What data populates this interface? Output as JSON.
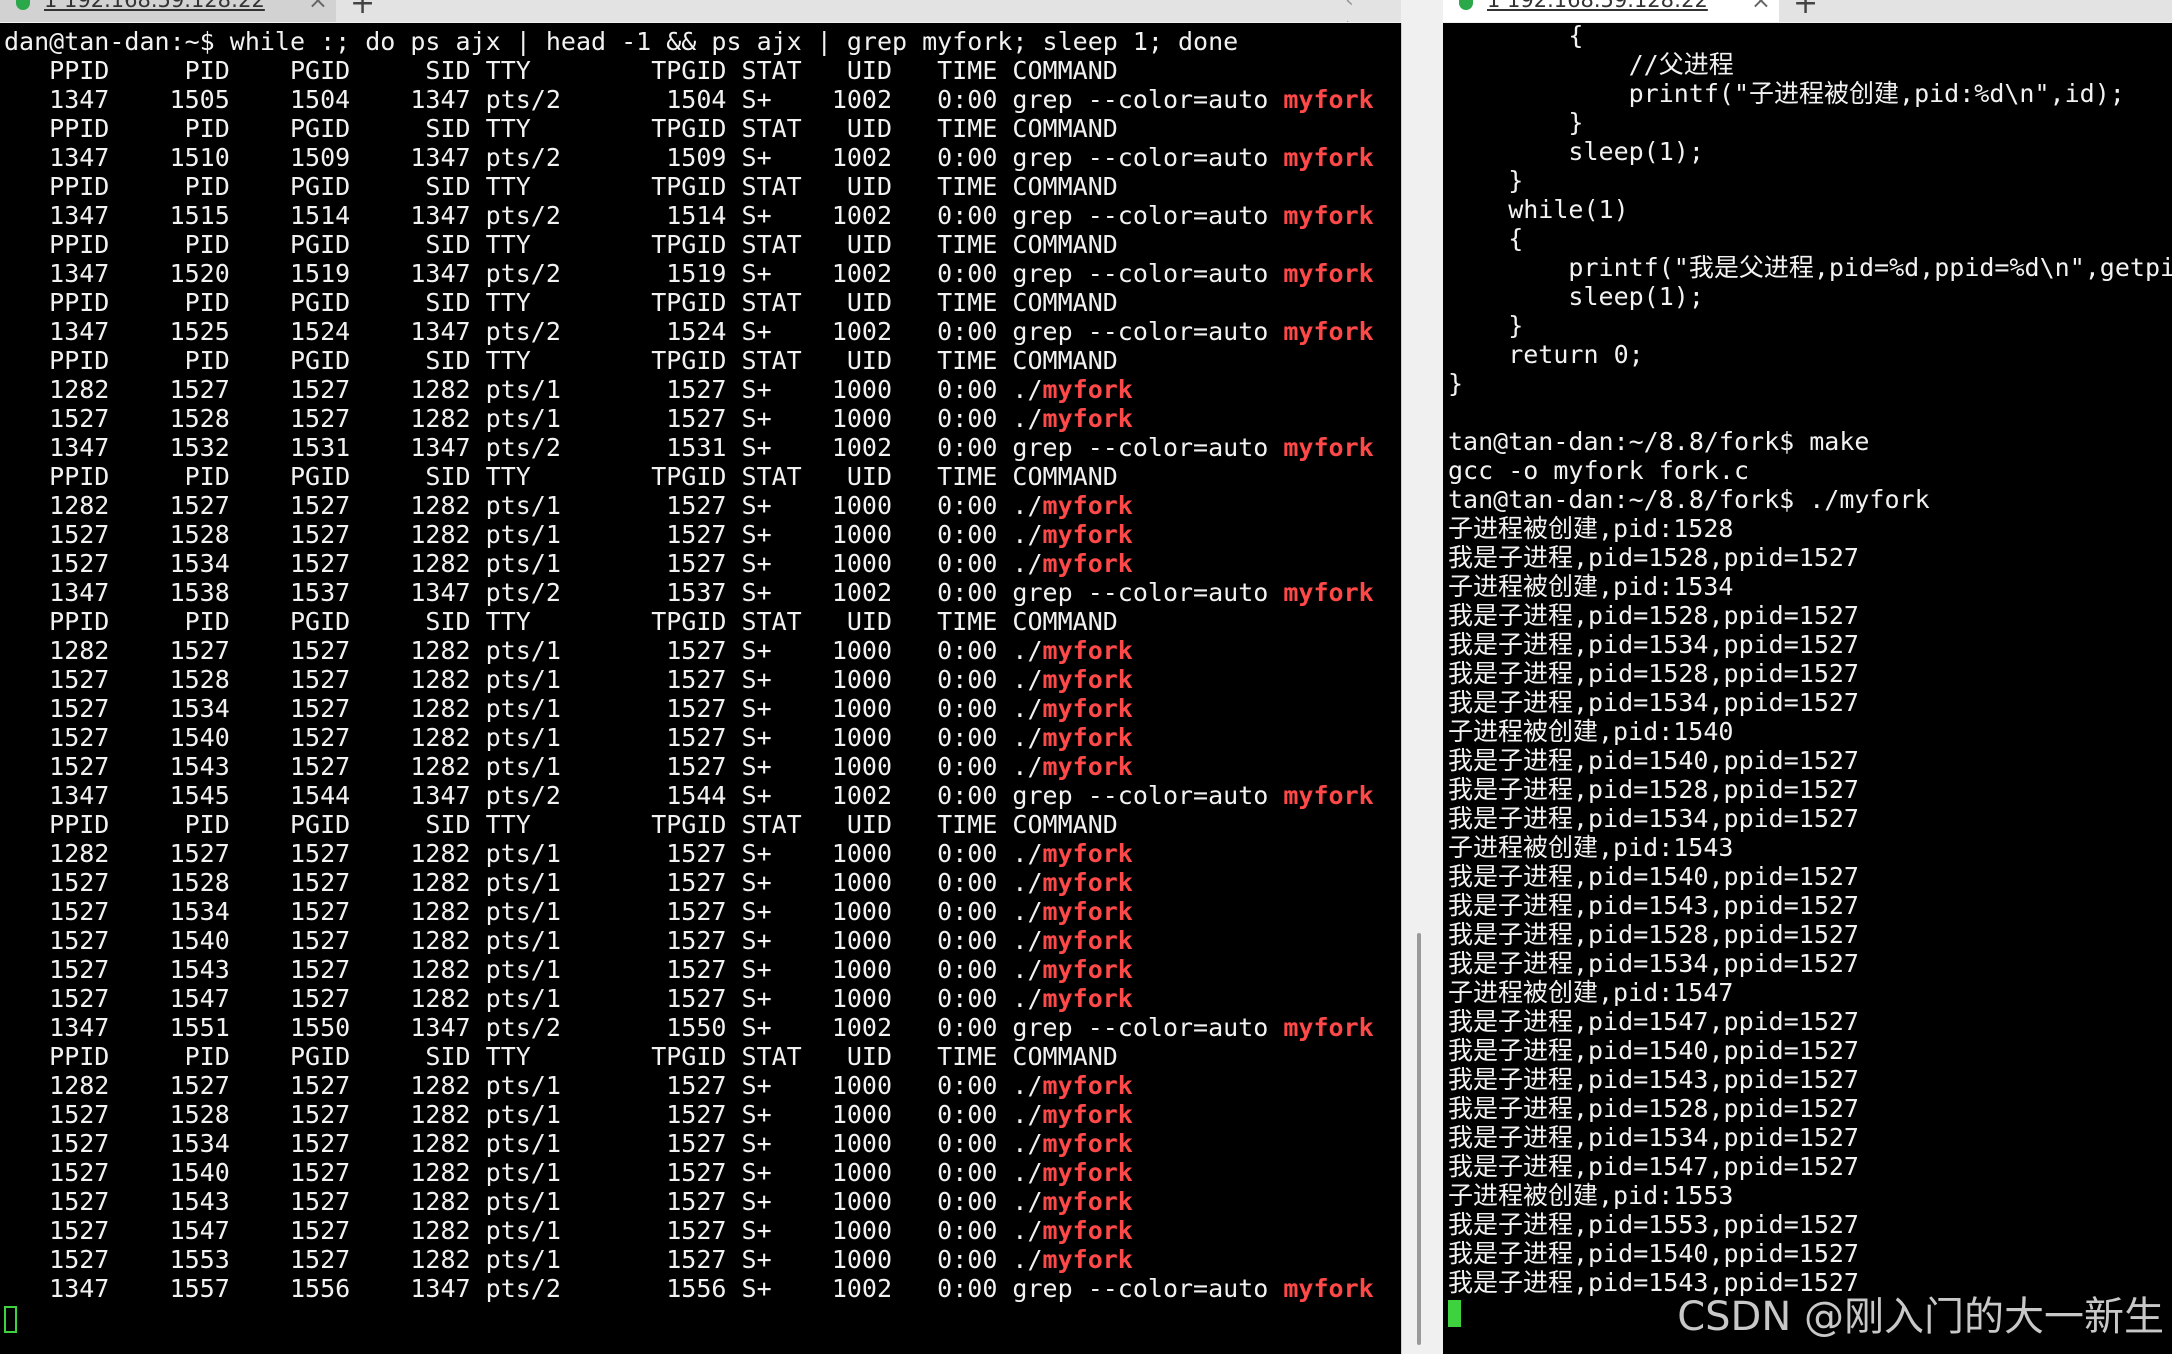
{
  "left_tab": {
    "label": "1 192.168.59.128:22",
    "close": "×",
    "new_tab": "+",
    "nav": "‹ ›"
  },
  "right_tab": {
    "label": "1 192.168.59.128:22",
    "close": "×",
    "new_tab": "+"
  },
  "left_terminal": {
    "lines": [
      [
        "dan@tan-dan:~$ while :; do ps ajx | head -1 && ps ajx | grep myfork; sleep 1; done",
        ""
      ],
      [
        "   PPID     PID    PGID     SID TTY        TPGID STAT   UID   TIME COMMAND",
        ""
      ],
      [
        "   1347    1505    1504    1347 pts/2       1504 S+    1002   0:00 grep --color=auto ",
        "myfork"
      ],
      [
        "   PPID     PID    PGID     SID TTY        TPGID STAT   UID   TIME COMMAND",
        ""
      ],
      [
        "   1347    1510    1509    1347 pts/2       1509 S+    1002   0:00 grep --color=auto ",
        "myfork"
      ],
      [
        "   PPID     PID    PGID     SID TTY        TPGID STAT   UID   TIME COMMAND",
        ""
      ],
      [
        "   1347    1515    1514    1347 pts/2       1514 S+    1002   0:00 grep --color=auto ",
        "myfork"
      ],
      [
        "   PPID     PID    PGID     SID TTY        TPGID STAT   UID   TIME COMMAND",
        ""
      ],
      [
        "   1347    1520    1519    1347 pts/2       1519 S+    1002   0:00 grep --color=auto ",
        "myfork"
      ],
      [
        "   PPID     PID    PGID     SID TTY        TPGID STAT   UID   TIME COMMAND",
        ""
      ],
      [
        "   1347    1525    1524    1347 pts/2       1524 S+    1002   0:00 grep --color=auto ",
        "myfork"
      ],
      [
        "   PPID     PID    PGID     SID TTY        TPGID STAT   UID   TIME COMMAND",
        ""
      ],
      [
        "   1282    1527    1527    1282 pts/1       1527 S+    1000   0:00 ./",
        "myfork"
      ],
      [
        "   1527    1528    1527    1282 pts/1       1527 S+    1000   0:00 ./",
        "myfork"
      ],
      [
        "   1347    1532    1531    1347 pts/2       1531 S+    1002   0:00 grep --color=auto ",
        "myfork"
      ],
      [
        "   PPID     PID    PGID     SID TTY        TPGID STAT   UID   TIME COMMAND",
        ""
      ],
      [
        "   1282    1527    1527    1282 pts/1       1527 S+    1000   0:00 ./",
        "myfork"
      ],
      [
        "   1527    1528    1527    1282 pts/1       1527 S+    1000   0:00 ./",
        "myfork"
      ],
      [
        "   1527    1534    1527    1282 pts/1       1527 S+    1000   0:00 ./",
        "myfork"
      ],
      [
        "   1347    1538    1537    1347 pts/2       1537 S+    1002   0:00 grep --color=auto ",
        "myfork"
      ],
      [
        "   PPID     PID    PGID     SID TTY        TPGID STAT   UID   TIME COMMAND",
        ""
      ],
      [
        "   1282    1527    1527    1282 pts/1       1527 S+    1000   0:00 ./",
        "myfork"
      ],
      [
        "   1527    1528    1527    1282 pts/1       1527 S+    1000   0:00 ./",
        "myfork"
      ],
      [
        "   1527    1534    1527    1282 pts/1       1527 S+    1000   0:00 ./",
        "myfork"
      ],
      [
        "   1527    1540    1527    1282 pts/1       1527 S+    1000   0:00 ./",
        "myfork"
      ],
      [
        "   1527    1543    1527    1282 pts/1       1527 S+    1000   0:00 ./",
        "myfork"
      ],
      [
        "   1347    1545    1544    1347 pts/2       1544 S+    1002   0:00 grep --color=auto ",
        "myfork"
      ],
      [
        "   PPID     PID    PGID     SID TTY        TPGID STAT   UID   TIME COMMAND",
        ""
      ],
      [
        "   1282    1527    1527    1282 pts/1       1527 S+    1000   0:00 ./",
        "myfork"
      ],
      [
        "   1527    1528    1527    1282 pts/1       1527 S+    1000   0:00 ./",
        "myfork"
      ],
      [
        "   1527    1534    1527    1282 pts/1       1527 S+    1000   0:00 ./",
        "myfork"
      ],
      [
        "   1527    1540    1527    1282 pts/1       1527 S+    1000   0:00 ./",
        "myfork"
      ],
      [
        "   1527    1543    1527    1282 pts/1       1527 S+    1000   0:00 ./",
        "myfork"
      ],
      [
        "   1527    1547    1527    1282 pts/1       1527 S+    1000   0:00 ./",
        "myfork"
      ],
      [
        "   1347    1551    1550    1347 pts/2       1550 S+    1002   0:00 grep --color=auto ",
        "myfork"
      ],
      [
        "   PPID     PID    PGID     SID TTY        TPGID STAT   UID   TIME COMMAND",
        ""
      ],
      [
        "   1282    1527    1527    1282 pts/1       1527 S+    1000   0:00 ./",
        "myfork"
      ],
      [
        "   1527    1528    1527    1282 pts/1       1527 S+    1000   0:00 ./",
        "myfork"
      ],
      [
        "   1527    1534    1527    1282 pts/1       1527 S+    1000   0:00 ./",
        "myfork"
      ],
      [
        "   1527    1540    1527    1282 pts/1       1527 S+    1000   0:00 ./",
        "myfork"
      ],
      [
        "   1527    1543    1527    1282 pts/1       1527 S+    1000   0:00 ./",
        "myfork"
      ],
      [
        "   1527    1547    1527    1282 pts/1       1527 S+    1000   0:00 ./",
        "myfork"
      ],
      [
        "   1527    1553    1527    1282 pts/1       1527 S+    1000   0:00 ./",
        "myfork"
      ],
      [
        "   1347    1557    1556    1347 pts/2       1556 S+    1002   0:00 grep --color=auto ",
        "myfork"
      ]
    ]
  },
  "right_terminal": {
    "lines": [
      "        {",
      "            //父进程",
      "            printf(\"子进程被创建,pid:%d\\n\",id);",
      "        }",
      "        sleep(1);",
      "    }",
      "    while(1)",
      "    {",
      "        printf(\"我是父进程,pid=%d,ppid=%d\\n\",getpid(",
      "        sleep(1);",
      "    }",
      "    return 0;",
      "}",
      "",
      "tan@tan-dan:~/8.8/fork$ make",
      "gcc -o myfork fork.c",
      "tan@tan-dan:~/8.8/fork$ ./myfork",
      "子进程被创建,pid:1528",
      "我是子进程,pid=1528,ppid=1527",
      "子进程被创建,pid:1534",
      "我是子进程,pid=1528,ppid=1527",
      "我是子进程,pid=1534,ppid=1527",
      "我是子进程,pid=1528,ppid=1527",
      "我是子进程,pid=1534,ppid=1527",
      "子进程被创建,pid:1540",
      "我是子进程,pid=1540,ppid=1527",
      "我是子进程,pid=1528,ppid=1527",
      "我是子进程,pid=1534,ppid=1527",
      "子进程被创建,pid:1543",
      "我是子进程,pid=1540,ppid=1527",
      "我是子进程,pid=1543,ppid=1527",
      "我是子进程,pid=1528,ppid=1527",
      "我是子进程,pid=1534,ppid=1527",
      "子进程被创建,pid:1547",
      "我是子进程,pid=1547,ppid=1527",
      "我是子进程,pid=1540,ppid=1527",
      "我是子进程,pid=1543,ppid=1527",
      "我是子进程,pid=1528,ppid=1527",
      "我是子进程,pid=1534,ppid=1527",
      "我是子进程,pid=1547,ppid=1527",
      "子进程被创建,pid:1553",
      "我是子进程,pid=1553,ppid=1527",
      "我是子进程,pid=1540,ppid=1527",
      "我是子进程,pid=1543,ppid=1527"
    ]
  },
  "watermark": "CSDN @刚入门的大一新生",
  "colors": {
    "highlight": "#ff4848",
    "cursor": "#3ed33e",
    "terminal_bg": "#000000",
    "text": "#f2f2f2"
  }
}
